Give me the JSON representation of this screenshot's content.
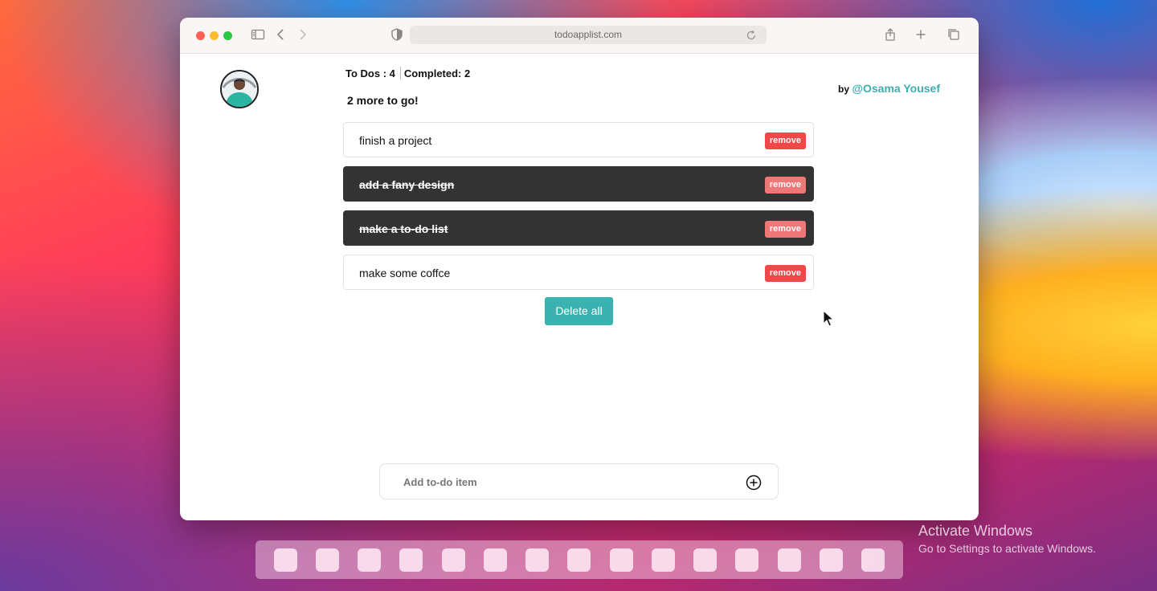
{
  "browser": {
    "url": "todoapplist.com"
  },
  "stats": {
    "todos_label": "To Dos : 4",
    "completed_label": "Completed: 2",
    "remaining_text": "2 more to go!"
  },
  "byline": {
    "by": "by",
    "author": "@Osama Yousef"
  },
  "todos": [
    {
      "text": "finish a project",
      "completed": false,
      "remove_label": "remove"
    },
    {
      "text": "add a fany design",
      "completed": true,
      "remove_label": "remove"
    },
    {
      "text": "make a to-do list",
      "completed": true,
      "remove_label": "remove"
    },
    {
      "text": "make some coffce",
      "completed": false,
      "remove_label": "remove"
    }
  ],
  "actions": {
    "delete_all": "Delete all"
  },
  "add_input": {
    "placeholder": "Add to-do item"
  },
  "os_overlay": {
    "activate_title": "Activate Windows",
    "activate_sub": "Go to Settings to activate Windows."
  },
  "colors": {
    "accent": "#3ab3b0",
    "remove": "#f04848",
    "done_bg": "#333333"
  }
}
